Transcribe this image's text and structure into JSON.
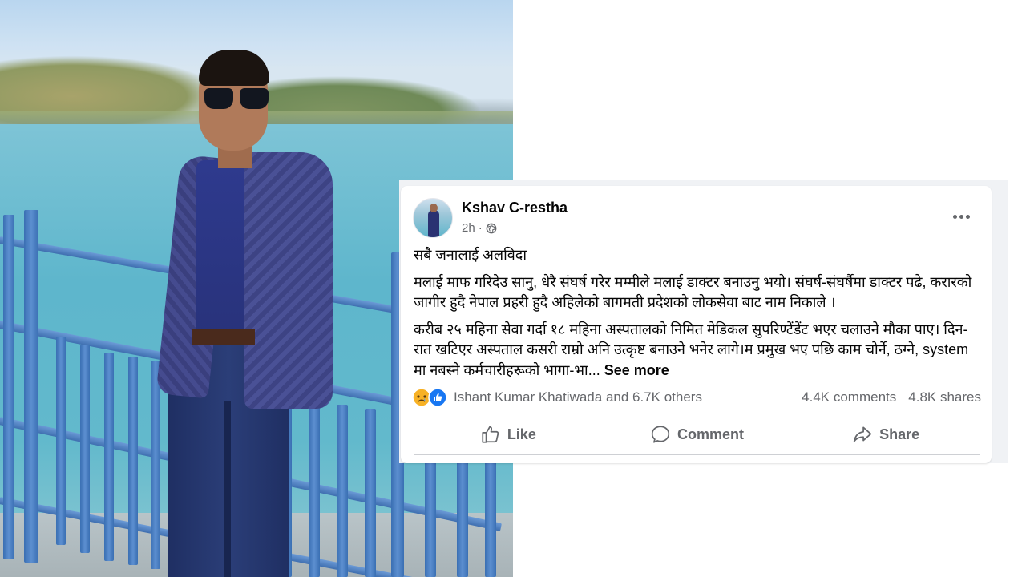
{
  "post": {
    "author": "Kshav C-restha",
    "time": "2h",
    "separator": "·",
    "privacy_icon": "globe-icon",
    "more_icon": "more-options-icon",
    "paragraphs": [
      "सबै जनालाई अलविदा",
      "मलाई माफ गरिदेउ सानु, धेरै संघर्ष गरेर मम्मीले मलाई डाक्टर बनाउनु भयो। संघर्ष-संघर्षैमा डाक्टर पढे, करारको जागीर हुदै नेपाल प्रहरी हुदै अहिलेको बागमती प्रदेशको लोकसेवा बाट नाम निकाले ।",
      "करीब २५ महिना सेवा गर्दा १८ महिना अस्पतालको निमित मेडिकल सुपरिण्टेंडेंट भएर चलाउने मौका पाए। दिन-रात खटिएर अस्पताल कसरी राम्रो अनि उत्कृष्ट बनाउने भनेर लागे।म प्रमुख भए पछि काम चोर्ने, ठग्ने, system मा नबस्ने कर्मचारीहरूको भागा-भा..."
    ],
    "see_more": "See more",
    "reactions_text": "Ishant Kumar Khatiwada and 6.7K others",
    "comments": "4.4K comments",
    "shares": "4.8K shares",
    "actions": {
      "like": "Like",
      "comment": "Comment",
      "share": "Share"
    },
    "colors": {
      "text": "#050505",
      "secondary": "#65676b",
      "like_blue": "#1877f2",
      "sad_yellow": "#f7b125",
      "divider": "#ced0d4"
    }
  }
}
